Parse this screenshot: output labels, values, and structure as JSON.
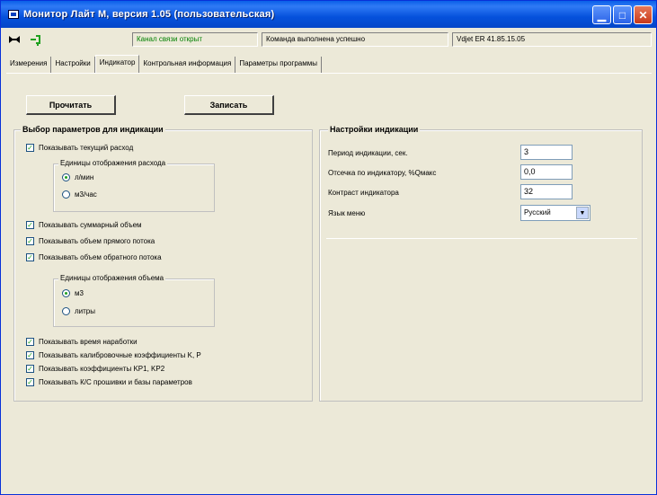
{
  "window": {
    "title": "Монитор Лайт М, версия 1.05 (пользовательская)",
    "minimize_icon": "minimize-icon",
    "maximize_icon": "maximize-icon",
    "close_icon": "close-icon"
  },
  "status": {
    "channel": "Канал связи открыт",
    "command": "Команда выполнена успешно",
    "device": "Vdjet ER 41.85.15.05",
    "channel_color": "#008000"
  },
  "tabs": [
    {
      "label": "Измерения"
    },
    {
      "label": "Настройки"
    },
    {
      "label": "Индикатор"
    },
    {
      "label": "Контрольная информация"
    },
    {
      "label": "Параметры программы"
    }
  ],
  "buttons": {
    "read": "Прочитать",
    "write": "Записать"
  },
  "left_group": {
    "title": "Выбор параметров для индикации",
    "show_flow": "Показывать текущий расход",
    "flow_units_title": "Единицы отображения расхода",
    "flow_unit_1": "л/мин",
    "flow_unit_2": "м3/час",
    "show_total": "Показывать суммарный объем",
    "show_forward": "Показывать объем прямого потока",
    "show_reverse": "Показывать объем обратного потока",
    "volume_units_title": "Единицы отображения объема",
    "volume_unit_1": "м3",
    "volume_unit_2": "литры",
    "show_runtime": "Показывать время наработки",
    "show_calib": "Показывать калибровочные коэффициенты K, P",
    "show_kp": "Показывать коэффициенты KP1, KP2",
    "show_crc": "Показывать К/С прошивки и базы параметров"
  },
  "right_group": {
    "title": "Настройки индикации",
    "period_label": "Период индикации, сек.",
    "period_value": "3",
    "cutoff_label": "Отсечка по индикатору, %Qмакс",
    "cutoff_value": "0,0",
    "contrast_label": "Контраст индикатора",
    "contrast_value": "32",
    "lang_label": "Язык меню",
    "lang_value": "Русский"
  }
}
